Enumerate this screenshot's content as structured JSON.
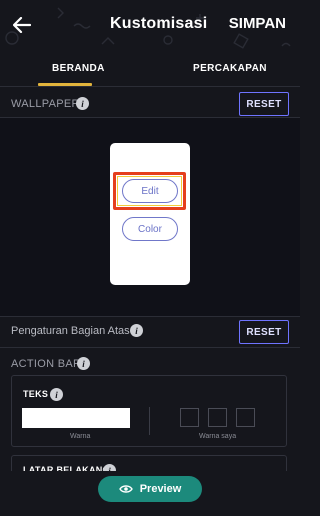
{
  "appbar": {
    "title": "Kustomisasi",
    "save_label": "SIMPAN"
  },
  "tabs": [
    {
      "label": "BERANDA",
      "active": true
    },
    {
      "label": "PERCAKAPAN",
      "active": false
    }
  ],
  "wallpaper": {
    "label": "WALLPAPER",
    "reset_label": "RESET",
    "edit_label": "Edit",
    "color_label": "Color"
  },
  "pengaturan": {
    "label": "Pengaturan Bagian Atas",
    "reset_label": "RESET"
  },
  "action_bar": {
    "label": "ACTION BAR",
    "teks_label": "TEKS",
    "warna_caption": "Warna",
    "warna_saya_caption": "Warna saya",
    "swatch_count": 3
  },
  "latar_belakang": {
    "label": "LATAR BELAKANG"
  },
  "preview": {
    "label": "Preview",
    "icon": "eye-icon"
  },
  "colors": {
    "background": "#15161c",
    "accent_tab": "#e2b43c",
    "reset_border": "#6f74ff",
    "preview_button": "#1c8a7c",
    "highlight_outer": "#e53f1d",
    "highlight_inner": "#f2cc3a"
  },
  "icons": {
    "back": "arrow-left-icon",
    "info": "info-icon"
  }
}
